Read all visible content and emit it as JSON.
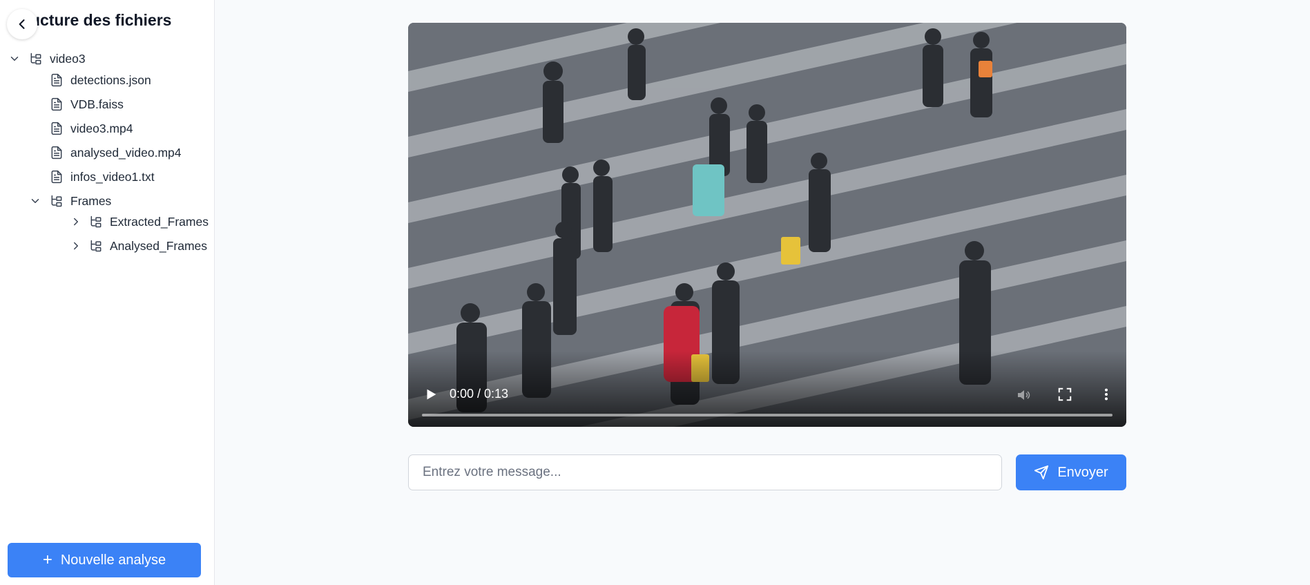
{
  "sidebar": {
    "title": "Structure des fichiers",
    "collapse_icon": "chevron-left-icon",
    "tree": [
      {
        "label": "video3",
        "type": "folder",
        "expanded": true,
        "depth": 0
      },
      {
        "label": "detections.json",
        "type": "file",
        "depth": 1
      },
      {
        "label": "VDB.faiss",
        "type": "file",
        "depth": 1
      },
      {
        "label": "video3.mp4",
        "type": "file",
        "depth": 1
      },
      {
        "label": "analysed_video.mp4",
        "type": "file",
        "depth": 1
      },
      {
        "label": "infos_video1.txt",
        "type": "file",
        "depth": 1
      },
      {
        "label": "Frames",
        "type": "folder",
        "expanded": true,
        "depth": 1
      },
      {
        "label": "Extracted_Frames",
        "type": "folder",
        "expanded": false,
        "depth": 2
      },
      {
        "label": "Analysed_Frames",
        "type": "folder",
        "expanded": false,
        "depth": 2
      }
    ],
    "new_analysis_label": "Nouvelle analyse"
  },
  "video": {
    "time": "0:00 / 0:13",
    "progress": 0
  },
  "chat": {
    "placeholder": "Entrez votre message...",
    "value": "",
    "send_label": "Envoyer"
  },
  "colors": {
    "accent": "#3b82f6",
    "background": "#f8fafc"
  }
}
